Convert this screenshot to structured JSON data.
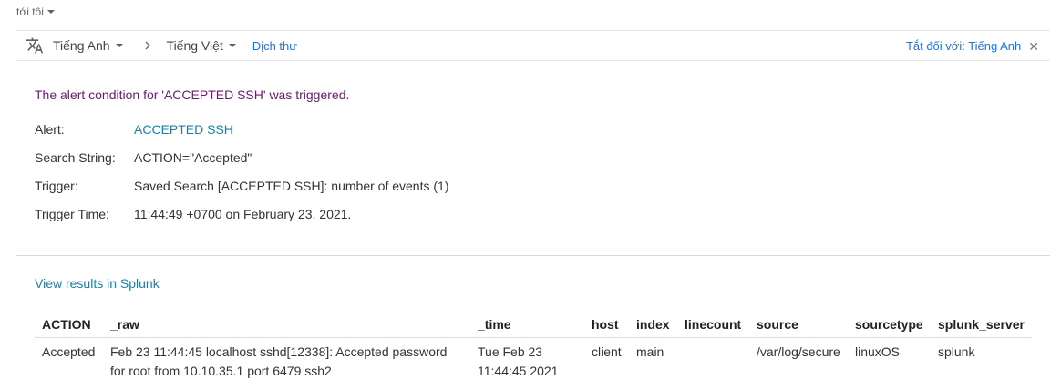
{
  "header": {
    "to_me": "tới tôi"
  },
  "translate_bar": {
    "source_lang": "Tiếng Anh",
    "target_lang": "Tiếng Việt",
    "translate_link": "Dịch thư",
    "turn_off": "Tắt đối với: Tiếng Anh"
  },
  "email": {
    "alert_line": "The alert condition for 'ACCEPTED SSH' was triggered.",
    "fields": [
      {
        "label": "Alert:",
        "value": "ACCEPTED SSH"
      },
      {
        "label": "Search String:",
        "value": "ACTION=\"Accepted\""
      },
      {
        "label": "Trigger:",
        "value": "Saved Search [ACCEPTED SSH]: number of events (1)"
      },
      {
        "label": "Trigger Time:",
        "value": "11:44:49 +0700 on February 23, 2021."
      }
    ],
    "view_results": "View results in Splunk"
  },
  "results_table": {
    "headers": [
      "ACTION",
      "_raw",
      "_time",
      "host",
      "index",
      "linecount",
      "source",
      "sourcetype",
      "splunk_server"
    ],
    "rows": [
      [
        "Accepted",
        "Feb 23 11:44:45 localhost sshd[12338]: Accepted password for root from 10.10.35.1 port 6479 ssh2",
        "Tue Feb 23 11:44:45 2021",
        "client",
        "main",
        "",
        "/var/log/secure",
        "linuxOS",
        "splunk"
      ]
    ]
  },
  "colors": {
    "link_blue": "#1a73e8",
    "splunk_link": "#1a7fa8",
    "alert_purple": "#6a1b6d"
  }
}
